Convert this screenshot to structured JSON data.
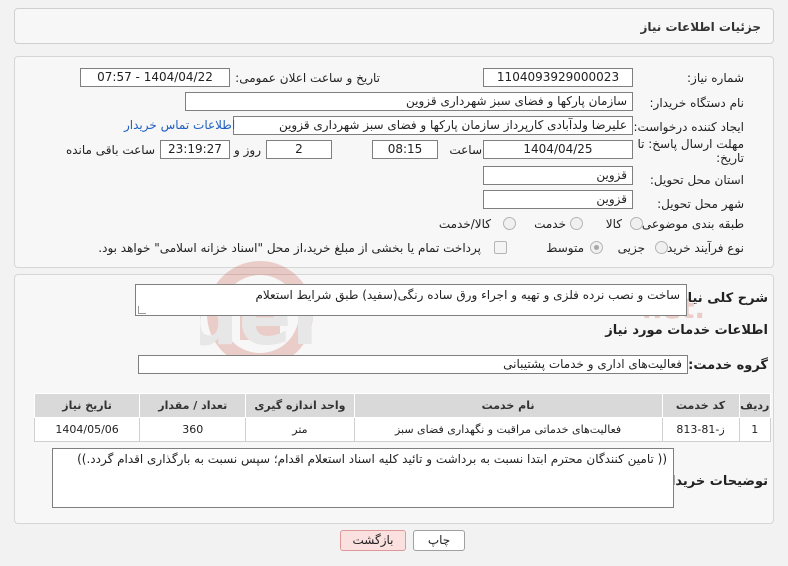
{
  "header": {
    "title": "جزئیات اطلاعات نیاز"
  },
  "form": {
    "need_number_label": "شماره نیاز:",
    "need_number": "1104093929000023",
    "announce_label": "تاریخ و ساعت اعلان عمومی:",
    "announce_value": "1404/04/22 - 07:57",
    "buyer_org_label": "نام دستگاه خریدار:",
    "buyer_org": "سازمان پارکها و فضای سبز شهرداری قزوین",
    "creator_label": "ایجاد کننده درخواست:",
    "creator": "علیرضا ولدآبادی کارپرداز سازمان پارکها و فضای سبز شهرداری قزوین",
    "contact_link": "اطلاعات تماس خریدار",
    "deadline_label_1": "مهلت ارسال پاسخ: تا",
    "deadline_label_2": "تاریخ:",
    "deadline_date": "1404/04/25",
    "time_label": "ساعت",
    "deadline_time": "08:15",
    "days_value": "2",
    "days_label": "روز و",
    "remaining_time": "23:19:27",
    "remaining_label": "ساعت باقی مانده",
    "province_label": "استان محل تحویل:",
    "province": "قزوین",
    "city_label": "شهر محل تحویل:",
    "city": "قزوین",
    "category_label": "طبقه بندی موضوعی:",
    "category_options": [
      "کالا",
      "خدمت",
      "کالا/خدمت"
    ],
    "process_label": "نوع فرآیند خرید :",
    "process_options": [
      "جزیی",
      "متوسط"
    ],
    "payment_note": "پرداخت تمام یا بخشی از مبلغ خرید،از محل \"اسناد خزانه اسلامی\" خواهد بود."
  },
  "description": {
    "label": "شرح کلی نیاز:",
    "text": "ساخت و نصب نرده فلزی و  تهیه و اجراء ورق ساده رنگی(سفید) طبق شرایط استعلام"
  },
  "services": {
    "section_title": "اطلاعات خدمات مورد نیاز",
    "group_label": "گروه خدمت:",
    "group_value": "فعالیت‌های اداری و خدمات پشتیبانی",
    "columns": [
      "ردیف",
      "کد خدمت",
      "نام خدمت",
      "واحد اندازه گیری",
      "تعداد / مقدار",
      "تاریخ نیاز"
    ],
    "rows": [
      [
        "1",
        "ز-81-813",
        "فعالیت‌های خدماتی مراقبت و نگهداری فضای سبز",
        "متر",
        "360",
        "1404/05/06"
      ]
    ]
  },
  "buyer_notes": {
    "label": "توضیحات خریدار:",
    "text": "(( تامین کنندگان محترم ابتدا نسبت به برداشت و تائید کلیه اسناد استعلام اقدام؛ سپس نسبت به بارگذاری اقدام گردد.))"
  },
  "buttons": {
    "print": "چاپ",
    "back": "بازگشت"
  },
  "colors": {
    "link": "#1f5fbf",
    "back_button": "#fbe0e0"
  }
}
